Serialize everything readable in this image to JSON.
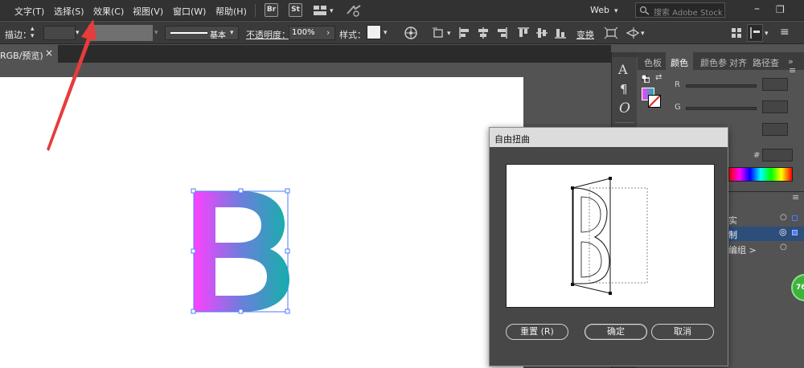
{
  "menubar": {
    "items": [
      {
        "label": "文字(T)"
      },
      {
        "label": "选择(S)"
      },
      {
        "label": "效果(C)"
      },
      {
        "label": "视图(V)"
      },
      {
        "label": "窗口(W)"
      },
      {
        "label": "帮助(H)"
      }
    ],
    "bridge": "Br",
    "stock": "St",
    "workspace": "Web",
    "search_placeholder": "搜索 Adobe Stock"
  },
  "controlbar": {
    "stroke_label": "描边：",
    "brush_label": "基本",
    "opacity_label": "不透明度：",
    "opacity_value": "100%",
    "style_label": "样式：",
    "transform_label": "变换"
  },
  "tabbar": {
    "doc_tab": "RGB/预览)",
    "close": "×"
  },
  "color_panel": {
    "tabs": [
      "色板",
      "颜色",
      "颜色参",
      "对齐",
      "路径查"
    ],
    "labels": {
      "r": "R",
      "g": "G",
      "hash": "#"
    }
  },
  "layers_panel": {
    "rows": [
      {
        "label": "实"
      },
      {
        "label": "制"
      },
      {
        "label": "编组 >"
      }
    ]
  },
  "dialog": {
    "title": "自由扭曲",
    "reset": "重置 (R)",
    "ok": "确定",
    "cancel": "取消"
  },
  "badge": "76",
  "colors": {
    "gradient_start": "#ff40ff",
    "gradient_end": "#13b1a8",
    "arrow": "#e63c3c"
  }
}
